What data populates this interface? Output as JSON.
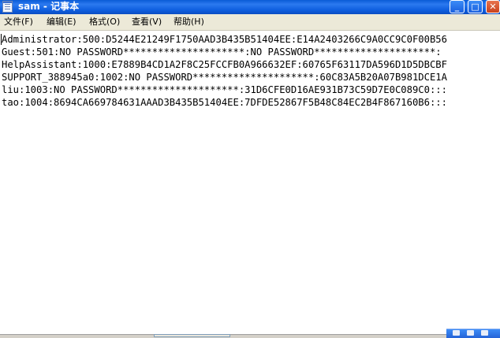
{
  "window": {
    "title": "sam - 记事本",
    "min_label": "_",
    "max_label": "□",
    "close_label": "✕"
  },
  "menu": {
    "file": "文件(F)",
    "edit": "编辑(E)",
    "format": "格式(O)",
    "view": "查看(V)",
    "help": "帮助(H)"
  },
  "content": {
    "lines": [
      "Administrator:500:D5244E21249F1750AAD3B435B51404EE:E14A2403266C9A0CC9C0F00B56",
      "Guest:501:NO PASSWORD*********************:NO PASSWORD*********************:",
      "HelpAssistant:1000:E7889B4CD1A2F8C25FCCFB0A966632EF:60765F63117DA596D1D5DBCBF",
      "SUPPORT_388945a0:1002:NO PASSWORD*********************:60C83A5B20A07B981DCE1A",
      "liu:1003:NO PASSWORD*********************:31D6CFE0D16AE931B73C59D7E0C089C0:::",
      "tao:1004:8694CA669784631AAAD3B435B51404EE:7DFDE52867F5B48C84EC2B4F867160B6:::"
    ]
  },
  "colors": {
    "titlebar": "#0a5bd6",
    "close_button": "#c8421d",
    "menubar": "#ece9d8"
  }
}
